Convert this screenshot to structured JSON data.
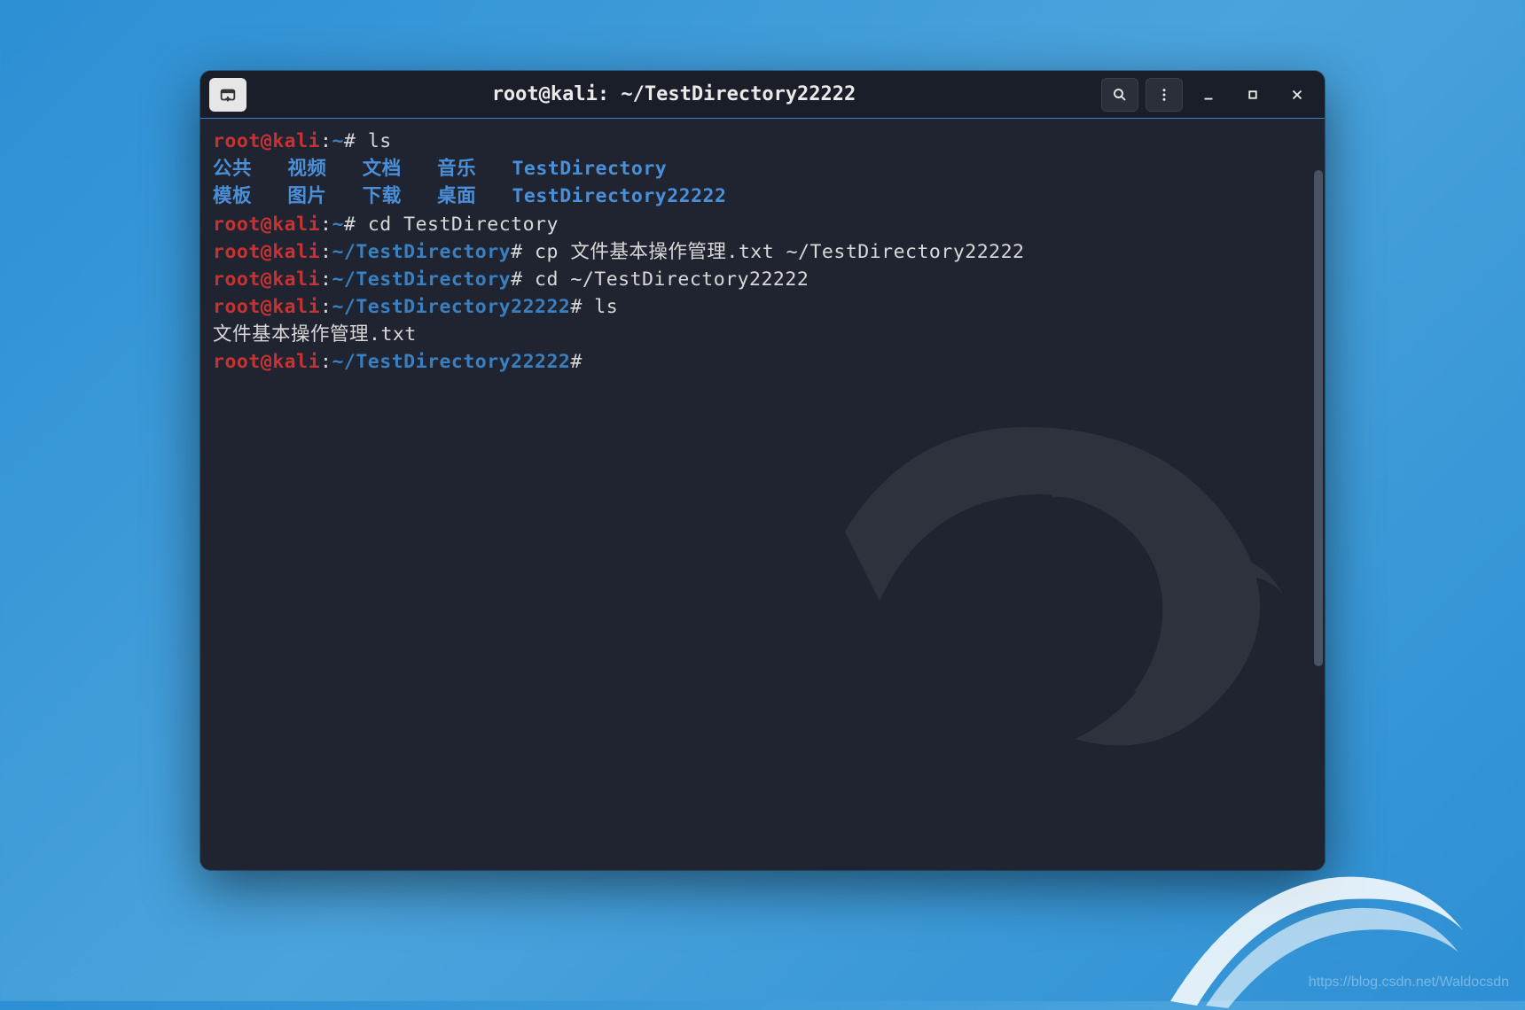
{
  "window": {
    "title": "root@kali: ~/TestDirectory22222"
  },
  "prompt": {
    "user": "root",
    "at": "@",
    "host": "kali",
    "home_path": "~",
    "dir1": "~/TestDirectory",
    "dir2": "~/TestDirectory22222",
    "sep": ":",
    "symbol": "#"
  },
  "commands": {
    "ls": "ls",
    "cd1": "cd TestDirectory",
    "cp": "cp 文件基本操作管理.txt ~/TestDirectory22222",
    "cd2": "cd ~/TestDirectory22222"
  },
  "ls_output": {
    "row1": [
      "公共",
      "视频",
      "文档",
      "音乐",
      "TestDirectory"
    ],
    "row2": [
      "模板",
      "图片",
      "下载",
      "桌面",
      "TestDirectory22222"
    ]
  },
  "ls_output2": "文件基本操作管理.txt",
  "watermark": "https://blog.csdn.net/Waldocsdn"
}
